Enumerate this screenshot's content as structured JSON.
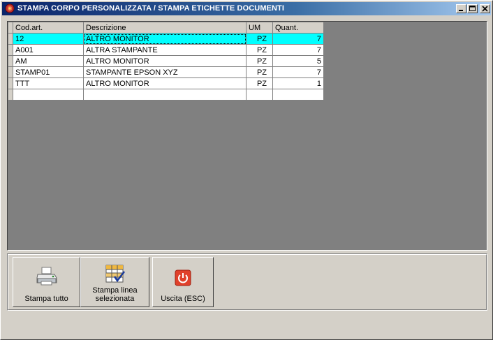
{
  "window": {
    "title": "STAMPA CORPO PERSONALIZZATA / STAMPA ETICHETTE DOCUMENTI"
  },
  "grid": {
    "columns": [
      "Cod.art.",
      "Descrizione",
      "UM",
      "Quant."
    ],
    "rows": [
      {
        "cod": "12",
        "desc": "ALTRO MONITOR",
        "um": "PZ",
        "qty": "7"
      },
      {
        "cod": "A001",
        "desc": "ALTRA STAMPANTE",
        "um": "PZ",
        "qty": "7"
      },
      {
        "cod": "AM",
        "desc": "ALTRO MONITOR",
        "um": "PZ",
        "qty": "5"
      },
      {
        "cod": "STAMP01",
        "desc": "STAMPANTE EPSON XYZ",
        "um": "PZ",
        "qty": "7"
      },
      {
        "cod": "TTT",
        "desc": "ALTRO MONITOR",
        "um": "PZ",
        "qty": "1"
      }
    ],
    "selected_row": 0
  },
  "toolbar": {
    "print_all_label": "Stampa tutto",
    "print_selected_line1": "Stampa linea",
    "print_selected_line2": "selezionata",
    "exit_label": "Uscita (ESC)"
  },
  "colors": {
    "selection": "#00ffff",
    "title_gradient_start": "#0a246a",
    "grid_background": "#808080"
  }
}
